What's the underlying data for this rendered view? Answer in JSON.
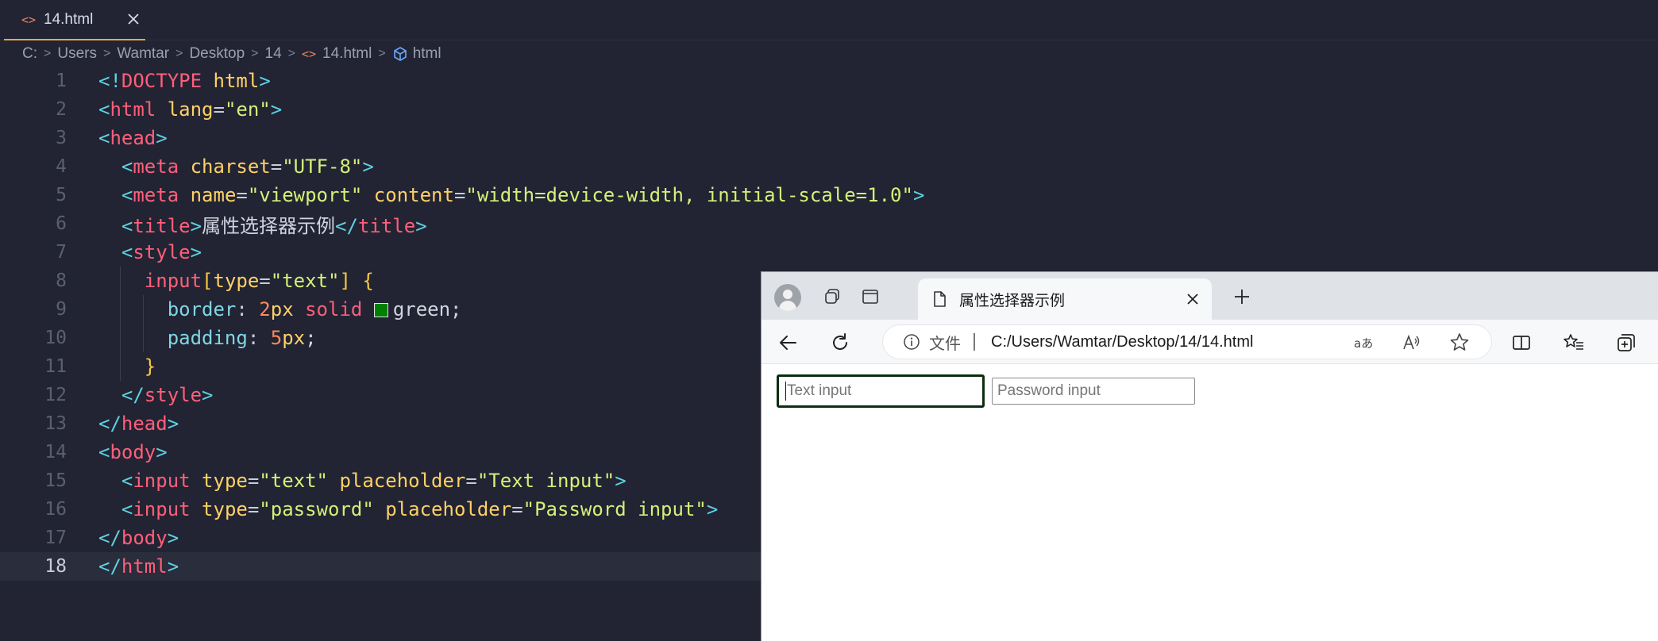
{
  "editor": {
    "tab": {
      "icon": "<>",
      "filename": "14.html"
    },
    "breadcrumb": [
      "C:",
      "Users",
      "Wamtar",
      "Desktop",
      "14",
      "14.html",
      "html"
    ],
    "current_line": 18,
    "lines": [
      {
        "n": 1,
        "indent": 0,
        "tokens": [
          [
            "punc",
            "<!"
          ],
          [
            "tag",
            "DOCTYPE"
          ],
          [
            "text",
            " "
          ],
          [
            "attr",
            "html"
          ],
          [
            "punc",
            ">"
          ]
        ]
      },
      {
        "n": 2,
        "indent": 0,
        "tokens": [
          [
            "punc",
            "<"
          ],
          [
            "tag",
            "html"
          ],
          [
            "text",
            " "
          ],
          [
            "attr",
            "lang"
          ],
          [
            "eq",
            "="
          ],
          [
            "str",
            "\"en\""
          ],
          [
            "punc",
            ">"
          ]
        ]
      },
      {
        "n": 3,
        "indent": 0,
        "tokens": [
          [
            "punc",
            "<"
          ],
          [
            "tag",
            "head"
          ],
          [
            "punc",
            ">"
          ]
        ]
      },
      {
        "n": 4,
        "indent": 1,
        "tokens": [
          [
            "punc",
            "<"
          ],
          [
            "tag",
            "meta"
          ],
          [
            "text",
            " "
          ],
          [
            "attr",
            "charset"
          ],
          [
            "eq",
            "="
          ],
          [
            "str",
            "\"UTF-8\""
          ],
          [
            "punc",
            ">"
          ]
        ]
      },
      {
        "n": 5,
        "indent": 1,
        "tokens": [
          [
            "punc",
            "<"
          ],
          [
            "tag",
            "meta"
          ],
          [
            "text",
            " "
          ],
          [
            "attr",
            "name"
          ],
          [
            "eq",
            "="
          ],
          [
            "str",
            "\"viewport\""
          ],
          [
            "text",
            " "
          ],
          [
            "attr",
            "content"
          ],
          [
            "eq",
            "="
          ],
          [
            "str",
            "\"width=device-width, initial-scale=1.0\""
          ],
          [
            "punc",
            ">"
          ]
        ]
      },
      {
        "n": 6,
        "indent": 1,
        "tokens": [
          [
            "punc",
            "<"
          ],
          [
            "tag",
            "title"
          ],
          [
            "punc",
            ">"
          ],
          [
            "text",
            "属性选择器示例"
          ],
          [
            "punc",
            "</"
          ],
          [
            "tag",
            "title"
          ],
          [
            "punc",
            ">"
          ]
        ]
      },
      {
        "n": 7,
        "indent": 1,
        "tokens": [
          [
            "punc",
            "<"
          ],
          [
            "tag",
            "style"
          ],
          [
            "punc",
            ">"
          ]
        ]
      },
      {
        "n": 8,
        "indent": 2,
        "tokens": [
          [
            "tag",
            "input"
          ],
          [
            "brace",
            "["
          ],
          [
            "attr",
            "type"
          ],
          [
            "eq",
            "="
          ],
          [
            "str",
            "\"text\""
          ],
          [
            "brace",
            "]"
          ],
          [
            "text",
            " "
          ],
          [
            "brace",
            "{"
          ]
        ]
      },
      {
        "n": 9,
        "indent": 3,
        "tokens": [
          [
            "prop",
            "border"
          ],
          [
            "eq",
            ": "
          ],
          [
            "num",
            "2"
          ],
          [
            "attr",
            "px"
          ],
          [
            "text",
            " "
          ],
          [
            "kw",
            "solid"
          ],
          [
            "text",
            " "
          ],
          [
            "swatch",
            ""
          ],
          [
            "text",
            "green;"
          ]
        ]
      },
      {
        "n": 10,
        "indent": 3,
        "tokens": [
          [
            "prop",
            "padding"
          ],
          [
            "eq",
            ": "
          ],
          [
            "num",
            "5"
          ],
          [
            "attr",
            "px"
          ],
          [
            "text",
            ";"
          ]
        ]
      },
      {
        "n": 11,
        "indent": 2,
        "tokens": [
          [
            "brace",
            "}"
          ]
        ]
      },
      {
        "n": 12,
        "indent": 1,
        "tokens": [
          [
            "punc",
            "</"
          ],
          [
            "tag",
            "style"
          ],
          [
            "punc",
            ">"
          ]
        ]
      },
      {
        "n": 13,
        "indent": 0,
        "tokens": [
          [
            "punc",
            "</"
          ],
          [
            "tag",
            "head"
          ],
          [
            "punc",
            ">"
          ]
        ]
      },
      {
        "n": 14,
        "indent": 0,
        "tokens": [
          [
            "punc",
            "<"
          ],
          [
            "tag",
            "body"
          ],
          [
            "punc",
            ">"
          ]
        ]
      },
      {
        "n": 15,
        "indent": 1,
        "tokens": [
          [
            "punc",
            "<"
          ],
          [
            "tag",
            "input"
          ],
          [
            "text",
            " "
          ],
          [
            "attr",
            "type"
          ],
          [
            "eq",
            "="
          ],
          [
            "str",
            "\"text\""
          ],
          [
            "text",
            " "
          ],
          [
            "attr",
            "placeholder"
          ],
          [
            "eq",
            "="
          ],
          [
            "str",
            "\"Text input\""
          ],
          [
            "punc",
            ">"
          ]
        ]
      },
      {
        "n": 16,
        "indent": 1,
        "tokens": [
          [
            "punc",
            "<"
          ],
          [
            "tag",
            "input"
          ],
          [
            "text",
            " "
          ],
          [
            "attr",
            "type"
          ],
          [
            "eq",
            "="
          ],
          [
            "str",
            "\"password\""
          ],
          [
            "text",
            " "
          ],
          [
            "attr",
            "placeholder"
          ],
          [
            "eq",
            "="
          ],
          [
            "str",
            "\"Password input\""
          ],
          [
            "punc",
            ">"
          ]
        ]
      },
      {
        "n": 17,
        "indent": 0,
        "tokens": [
          [
            "punc",
            "</"
          ],
          [
            "tag",
            "body"
          ],
          [
            "punc",
            ">"
          ]
        ]
      },
      {
        "n": 18,
        "indent": 0,
        "tokens": [
          [
            "punc",
            "</"
          ],
          [
            "tag",
            "html"
          ],
          [
            "punc",
            ">"
          ]
        ]
      }
    ]
  },
  "browser": {
    "tab_title": "属性选择器示例",
    "address": {
      "scheme_label": "文件",
      "url": "C:/Users/Wamtar/Desktop/14/14.html"
    },
    "page": {
      "text_input_placeholder": "Text input",
      "password_input_placeholder": "Password input"
    }
  },
  "colors": {
    "editor_bg": "#222433",
    "accent_tab": "#e5a74b",
    "swatch_green": "#008000",
    "text_input_border": "#0c2d12"
  }
}
